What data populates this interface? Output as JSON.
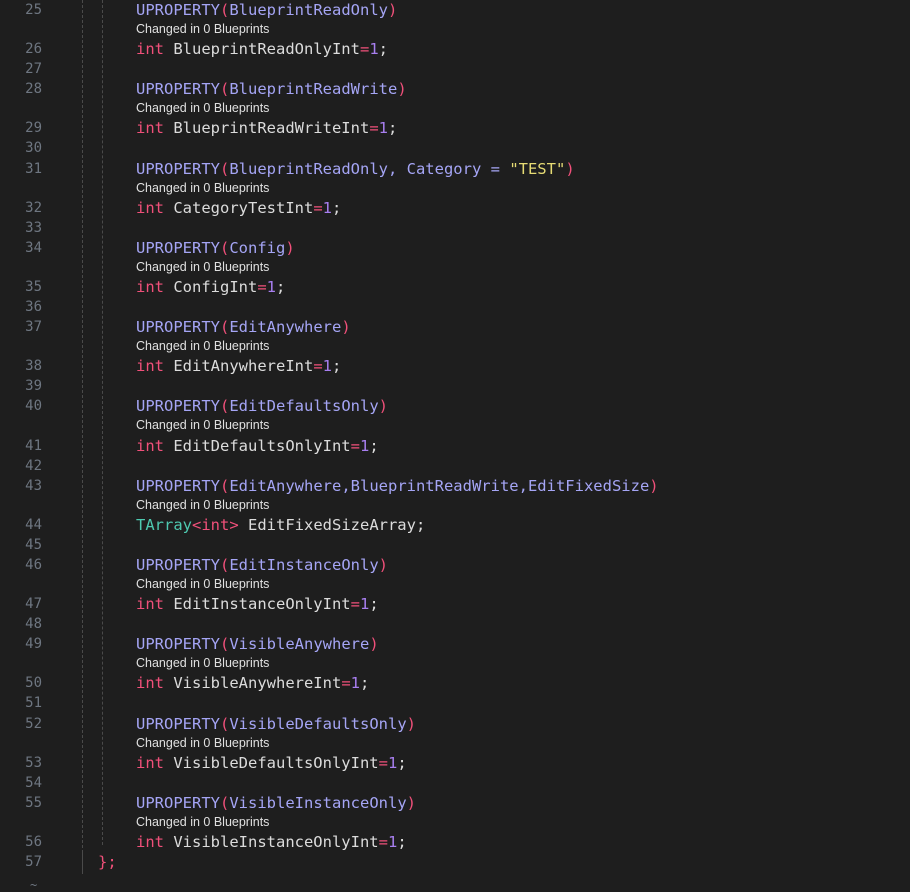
{
  "hint_text": "Changed in 0 Blueprints",
  "colors": {
    "background": "#1e1e1e",
    "line_number": "#6e7681",
    "macro": "#a5a5f5",
    "keyword": "#f0507a",
    "number": "#a87ff0",
    "string": "#e6db74",
    "type": "#4ec9b0"
  },
  "lines": [
    {
      "no": "25",
      "macro": "UPROPERTY",
      "args": "BlueprintReadOnly"
    },
    {
      "no": "26",
      "type": "int",
      "name": "BlueprintReadOnlyInt",
      "value": "1"
    },
    {
      "no": "27"
    },
    {
      "no": "28",
      "macro": "UPROPERTY",
      "args": "BlueprintReadWrite"
    },
    {
      "no": "29",
      "type": "int",
      "name": "BlueprintReadWriteInt",
      "value": "1"
    },
    {
      "no": "30"
    },
    {
      "no": "31",
      "macro": "UPROPERTY",
      "args": "BlueprintReadOnly, Category = ",
      "string_arg": "\"TEST\""
    },
    {
      "no": "32",
      "type": "int",
      "name": "CategoryTestInt",
      "value": "1"
    },
    {
      "no": "33"
    },
    {
      "no": "34",
      "macro": "UPROPERTY",
      "args": "Config"
    },
    {
      "no": "35",
      "type": "int",
      "name": "ConfigInt",
      "value": "1"
    },
    {
      "no": "36"
    },
    {
      "no": "37",
      "macro": "UPROPERTY",
      "args": "EditAnywhere"
    },
    {
      "no": "38",
      "type": "int",
      "name": "EditAnywhereInt",
      "value": "1"
    },
    {
      "no": "39"
    },
    {
      "no": "40",
      "macro": "UPROPERTY",
      "args": "EditDefaultsOnly"
    },
    {
      "no": "41",
      "type": "int",
      "name": "EditDefaultsOnlyInt",
      "value": "1"
    },
    {
      "no": "42"
    },
    {
      "no": "43",
      "macro": "UPROPERTY",
      "args": "EditAnywhere,BlueprintReadWrite,EditFixedSize"
    },
    {
      "no": "44",
      "tarray": "TArray",
      "tarray_arg": "<int>",
      "name": "EditFixedSizeArray"
    },
    {
      "no": "45"
    },
    {
      "no": "46",
      "macro": "UPROPERTY",
      "args": "EditInstanceOnly"
    },
    {
      "no": "47",
      "type": "int",
      "name": "EditInstanceOnlyInt",
      "value": "1"
    },
    {
      "no": "48"
    },
    {
      "no": "49",
      "macro": "UPROPERTY",
      "args": "VisibleAnywhere"
    },
    {
      "no": "50",
      "type": "int",
      "name": "VisibleAnywhereInt",
      "value": "1"
    },
    {
      "no": "51"
    },
    {
      "no": "52",
      "macro": "UPROPERTY",
      "args": "VisibleDefaultsOnly"
    },
    {
      "no": "53",
      "type": "int",
      "name": "VisibleDefaultsOnlyInt",
      "value": "1"
    },
    {
      "no": "54"
    },
    {
      "no": "55",
      "macro": "UPROPERTY",
      "args": "VisibleInstanceOnly"
    },
    {
      "no": "56",
      "type": "int",
      "name": "VisibleInstanceOnlyInt",
      "value": "1"
    },
    {
      "no": "57",
      "closing": "};"
    }
  ],
  "tilde": "~"
}
